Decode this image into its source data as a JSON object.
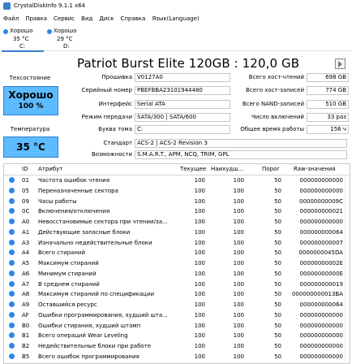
{
  "window": {
    "title": "CrystalDiskInfo 9.1.1 x64"
  },
  "menu": [
    "Файл",
    "Правка",
    "Сервис",
    "Вид",
    "Диск",
    "Справка",
    "Язык(Language)"
  ],
  "drives": [
    {
      "status": "Хорошо",
      "temp": "35 °C",
      "letter": "C:"
    },
    {
      "status": "Хорошо",
      "temp": "29 °C",
      "letter": "D:"
    }
  ],
  "model": "Patriot Burst Elite 120GB : 120,0 GB",
  "left": {
    "tech_label": "Техсостояние",
    "health_status": "Хорошо",
    "health_pct": "100 %",
    "temp_label": "Температура",
    "temp_value": "35 °C"
  },
  "info_left": [
    {
      "label": "Прошивка",
      "value": "V0127A0"
    },
    {
      "label": "Серийный номер",
      "value": "PBEFBBA23101944480"
    },
    {
      "label": "Интерфейс",
      "value": "Serial ATA"
    },
    {
      "label": "Режим передачи",
      "value": "SATA/300 | SATA/600"
    },
    {
      "label": "Буква тома",
      "value": "C:"
    }
  ],
  "info_right": [
    {
      "label": "Всего хост-чтений",
      "value": "698 GB"
    },
    {
      "label": "Всего хост-записей",
      "value": "774 GB"
    },
    {
      "label": "Всего NAND-записей",
      "value": "510 GB"
    },
    {
      "label": "Число включений",
      "value": "33 раз"
    },
    {
      "label": "Общее время работы",
      "value": "156 ч"
    }
  ],
  "standard": {
    "label": "Стандарт",
    "value": "ACS-2 | ACS-2 Revision 3"
  },
  "features": {
    "label": "Возможности",
    "value": "S.M.A.R.T., APM, NCQ, TRIM, GPL"
  },
  "table": {
    "headers": {
      "id": "ID",
      "attr": "Атрибут",
      "cur": "Текущее",
      "worst": "Наихудш...",
      "thr": "Порог",
      "raw": "Raw-значения"
    },
    "rows": [
      {
        "id": "01",
        "attr": "Частота ошибок чтения",
        "cur": "100",
        "worst": "100",
        "thr": "50",
        "raw": "000000000000"
      },
      {
        "id": "05",
        "attr": "Переназначенные сектора",
        "cur": "100",
        "worst": "100",
        "thr": "50",
        "raw": "000000000000"
      },
      {
        "id": "09",
        "attr": "Часы работы",
        "cur": "100",
        "worst": "100",
        "thr": "50",
        "raw": "00000000009C"
      },
      {
        "id": "0C",
        "attr": "Включения/отключения",
        "cur": "100",
        "worst": "100",
        "thr": "50",
        "raw": "000000000021"
      },
      {
        "id": "A0",
        "attr": "Невосстановимые сектора при чтении/за...",
        "cur": "100",
        "worst": "100",
        "thr": "50",
        "raw": "000000000000"
      },
      {
        "id": "A1",
        "attr": "Действующие запасные блоки",
        "cur": "100",
        "worst": "100",
        "thr": "50",
        "raw": "000000000064"
      },
      {
        "id": "A3",
        "attr": "Изначально недействительные блоки",
        "cur": "100",
        "worst": "100",
        "thr": "50",
        "raw": "000000000007"
      },
      {
        "id": "A4",
        "attr": "Всего стираний",
        "cur": "100",
        "worst": "100",
        "thr": "50",
        "raw": "0000000045DA"
      },
      {
        "id": "A5",
        "attr": "Максимум стираний",
        "cur": "100",
        "worst": "100",
        "thr": "50",
        "raw": "00000000002E"
      },
      {
        "id": "A6",
        "attr": "Минимум стираний",
        "cur": "100",
        "worst": "100",
        "thr": "50",
        "raw": "00000000000E"
      },
      {
        "id": "A7",
        "attr": "В среднем стираний",
        "cur": "100",
        "worst": "100",
        "thr": "50",
        "raw": "000000000019"
      },
      {
        "id": "A8",
        "attr": "Максимум стираний по спецификации",
        "cur": "100",
        "worst": "100",
        "thr": "50",
        "raw": "000000000013BA"
      },
      {
        "id": "A9",
        "attr": "Оставшийся ресурс",
        "cur": "100",
        "worst": "100",
        "thr": "50",
        "raw": "000000000064"
      },
      {
        "id": "AF",
        "attr": "Ошибки программирования, худший шта...",
        "cur": "100",
        "worst": "100",
        "thr": "50",
        "raw": "000000000000"
      },
      {
        "id": "B0",
        "attr": "Ошибки стирания, худший штамп",
        "cur": "100",
        "worst": "100",
        "thr": "50",
        "raw": "000000000000"
      },
      {
        "id": "B1",
        "attr": "Всего операций Wear Leveling",
        "cur": "100",
        "worst": "100",
        "thr": "50",
        "raw": "000000000000"
      },
      {
        "id": "B2",
        "attr": "Недействительные блоки при работе",
        "cur": "100",
        "worst": "100",
        "thr": "50",
        "raw": "000000000000"
      },
      {
        "id": "B5",
        "attr": "Всего ошибок программирования",
        "cur": "100",
        "worst": "100",
        "thr": "50",
        "raw": "000000000000"
      }
    ]
  }
}
